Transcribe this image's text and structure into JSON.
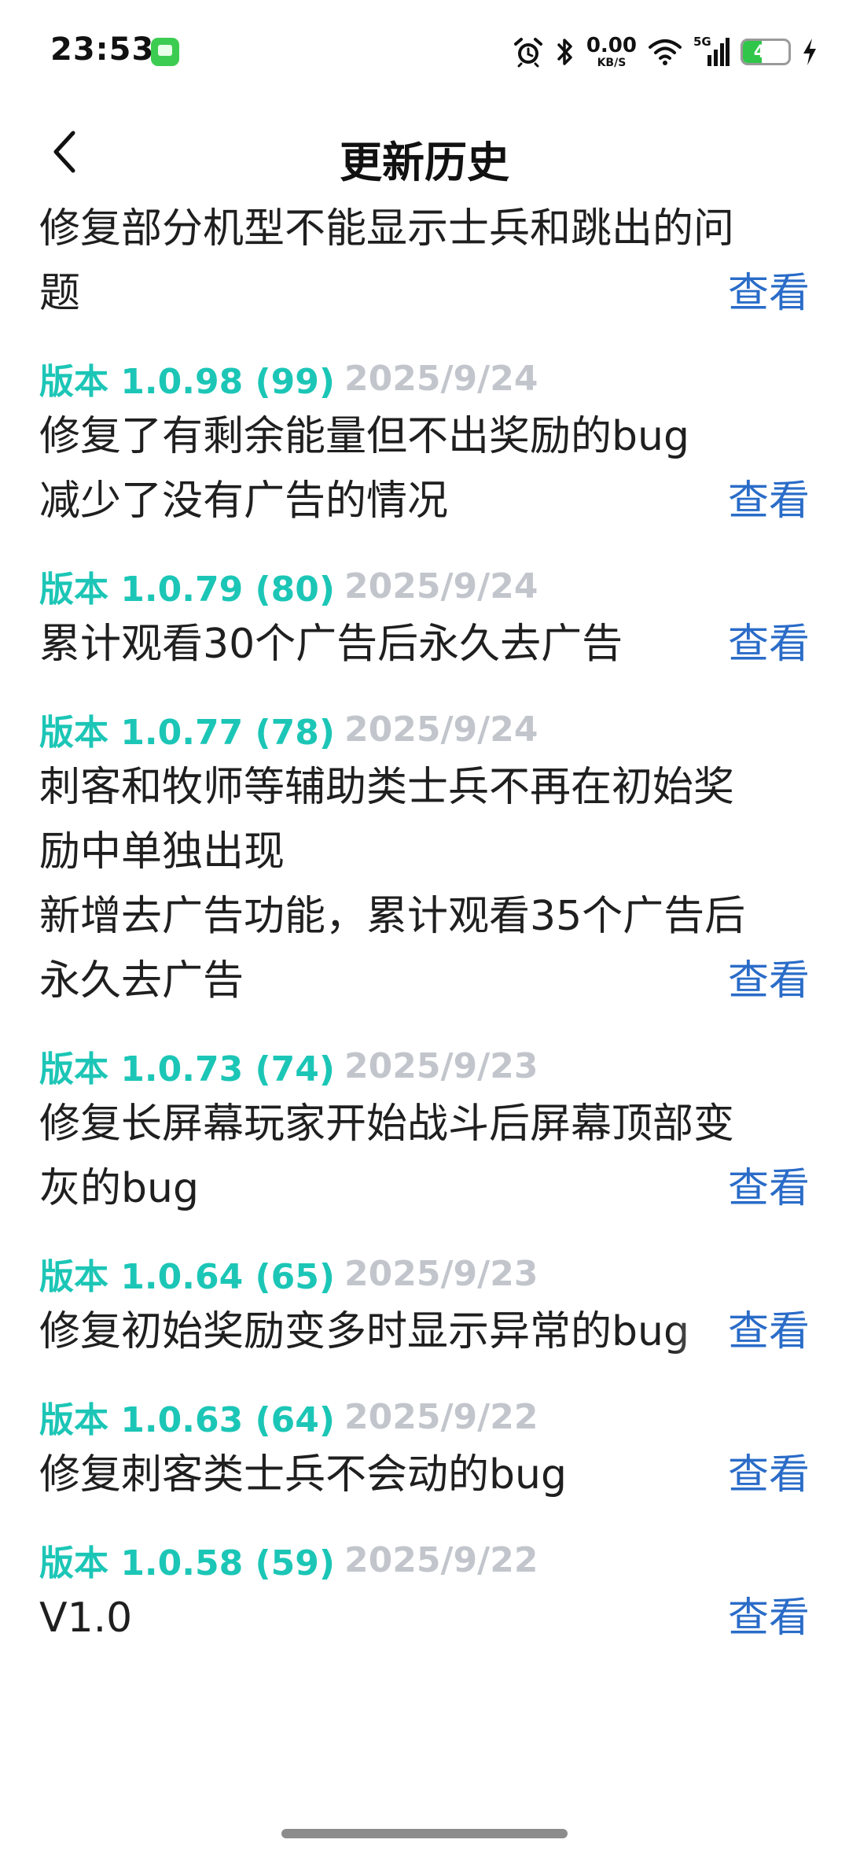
{
  "status_bar": {
    "time": "23:53",
    "net_speed_value": "0.00",
    "net_speed_unit": "KB/S",
    "signal_label": "5G",
    "battery_level": "41",
    "battery_fraction": 0.41,
    "icons": [
      "alarm-icon",
      "bluetooth-icon",
      "wifi-icon",
      "cellular-signal-icon",
      "battery-icon",
      "charging-icon"
    ]
  },
  "header": {
    "title": "更新历史",
    "back_icon": "chevron-left-icon"
  },
  "colors": {
    "version": "#1cc6b6",
    "date": "#c2c6cc",
    "link": "#2a6cc8",
    "battery_fill": "#2fc64a"
  },
  "entries": [
    {
      "version": "",
      "date": "",
      "lines": [
        "修复部分机型不能显示士兵和跳出的问",
        "题"
      ],
      "fade": false,
      "link": "查看"
    },
    {
      "version": "版本 1.0.98 (99)",
      "date": "2025/9/24",
      "lines": [
        "修复了有剩余能量但不出奖励的bug",
        "减少了没有广告的情况"
      ],
      "fade": false,
      "link": "查看"
    },
    {
      "version": "版本 1.0.79 (80)",
      "date": "2025/9/24",
      "lines": [
        "累计观看30个广告后永久去广告"
      ],
      "fade": true,
      "link": "查看"
    },
    {
      "version": "版本 1.0.77 (78)",
      "date": "2025/9/24",
      "lines": [
        "刺客和牧师等辅助类士兵不再在初始奖",
        "励中单独出现",
        "新增去广告功能，累计观看35个广告后",
        "永久去广告"
      ],
      "fade": false,
      "link": "查看"
    },
    {
      "version": "版本 1.0.73 (74)",
      "date": "2025/9/23",
      "lines": [
        "修复长屏幕玩家开始战斗后屏幕顶部变",
        "灰的bug"
      ],
      "fade": false,
      "link": "查看"
    },
    {
      "version": "版本 1.0.64 (65)",
      "date": "2025/9/23",
      "lines": [
        "修复初始奖励变多时显示异常的bug"
      ],
      "fade": true,
      "link": "查看"
    },
    {
      "version": "版本 1.0.63 (64)",
      "date": "2025/9/22",
      "lines": [
        "修复刺客类士兵不会动的bug"
      ],
      "fade": false,
      "link": "查看"
    },
    {
      "version": "版本 1.0.58 (59)",
      "date": "2025/9/22",
      "lines": [
        "V1.0"
      ],
      "fade": false,
      "link": "查看"
    }
  ]
}
